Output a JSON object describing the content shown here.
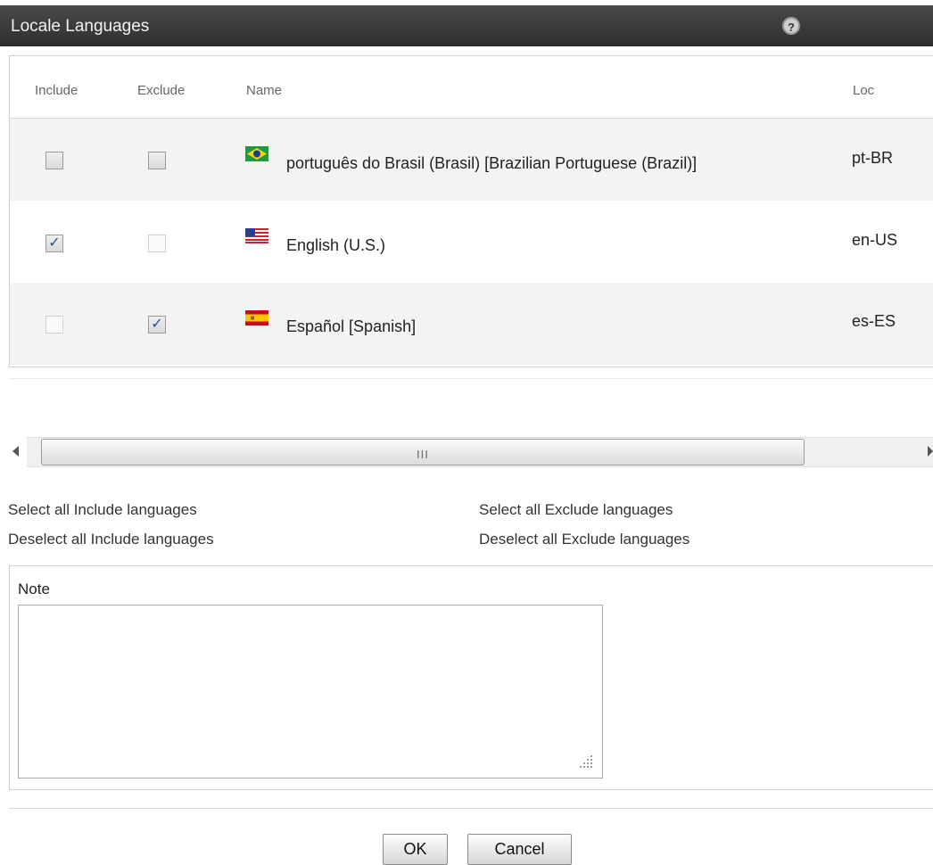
{
  "dialog": {
    "title": "Locale Languages",
    "help_icon": "help-icon"
  },
  "table": {
    "columns": {
      "include": "Include",
      "exclude": "Exclude",
      "name": "Name",
      "loc": "Loc"
    },
    "rows": [
      {
        "name": "português do Brasil (Brasil) [Brazilian Portuguese (Brazil)]",
        "loc": "pt-BR",
        "flag": "brazil-flag-icon",
        "include": false,
        "exclude": false
      },
      {
        "name": "English (U.S.)",
        "loc": "en-US",
        "flag": "us-flag-icon",
        "include": true,
        "exclude": false
      },
      {
        "name": "Español [Spanish]",
        "loc": "es-ES",
        "flag": "spain-flag-icon",
        "include": false,
        "exclude": true
      }
    ]
  },
  "scrollbar": {
    "grip": "III"
  },
  "links": {
    "select_all_include": "Select all Include languages",
    "deselect_all_include": "Deselect all Include languages",
    "select_all_exclude": "Select all Exclude languages",
    "deselect_all_exclude": "Deselect all Exclude languages"
  },
  "note": {
    "label": "Note",
    "value": ""
  },
  "buttons": {
    "ok": "OK",
    "cancel": "Cancel"
  },
  "check_mark": "✓",
  "colors": {
    "titlebar": "#3a3a3a",
    "row_alt": "#f3f3f3"
  }
}
